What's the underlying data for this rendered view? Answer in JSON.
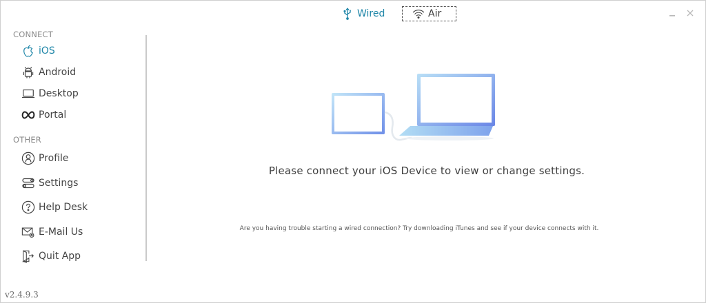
{
  "modes": {
    "wired": {
      "label": "Wired",
      "icon": "usb-icon"
    },
    "air": {
      "label": "Air",
      "icon": "wifi-icon"
    }
  },
  "sidebar": {
    "connect_label": "CONNECT",
    "other_label": "OTHER",
    "connect_items": [
      {
        "label": "iOS",
        "icon": "apple-icon",
        "active": true
      },
      {
        "label": "Android",
        "icon": "android-icon"
      },
      {
        "label": "Desktop",
        "icon": "laptop-icon"
      },
      {
        "label": "Portal",
        "icon": "meta-icon"
      }
    ],
    "other_items": [
      {
        "label": "Profile",
        "icon": "user-icon"
      },
      {
        "label": "Settings",
        "icon": "toggles-icon"
      },
      {
        "label": "Help Desk",
        "icon": "question-icon"
      },
      {
        "label": "E-Mail Us",
        "icon": "mail-icon"
      },
      {
        "label": "Quit App",
        "icon": "exit-icon"
      }
    ]
  },
  "main": {
    "message": "Please connect your iOS Device to view or change settings.",
    "help_note": "Are you having trouble starting a wired connection?  Try downloading iTunes and see if your device connects with it."
  },
  "footer": {
    "version": "v2.4.9.3"
  },
  "colors": {
    "accent": "#1f86a8",
    "device_gradient_start": "#bfe3f7",
    "device_gradient_end": "#6a86e6"
  }
}
